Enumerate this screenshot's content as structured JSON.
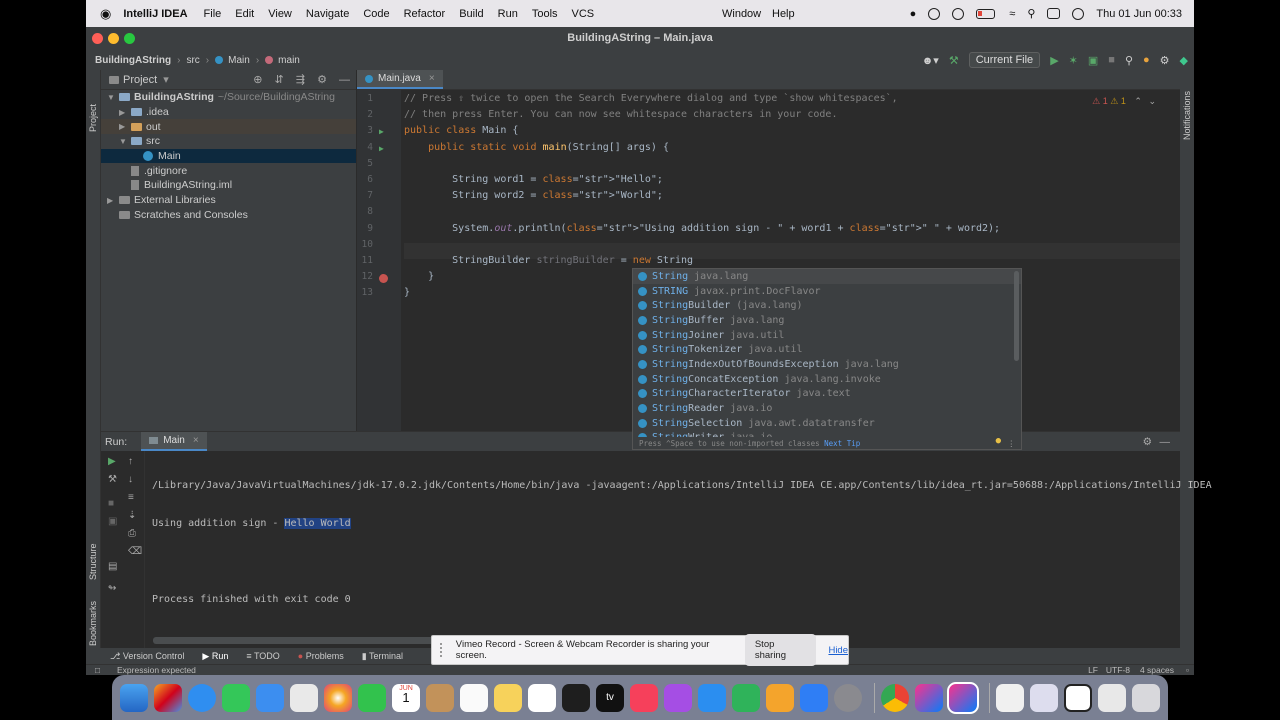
{
  "menubar": {
    "apple": "",
    "app": "IntelliJ IDEA",
    "items": [
      "File",
      "Edit",
      "View",
      "Navigate",
      "Code",
      "Refactor",
      "Build",
      "Run",
      "Tools",
      "VCS"
    ],
    "right_items": [
      "Window",
      "Help"
    ],
    "clock": "Thu 01 Jun  00:33"
  },
  "window": {
    "title": "BuildingAString – Main.java",
    "breadcrumb": [
      "BuildingAString",
      "src",
      "Main",
      "main"
    ],
    "run_config": "Current File"
  },
  "project": {
    "label": "Project",
    "tree": [
      {
        "name": "BuildingAString",
        "extra": "~/Source/BuildingAString",
        "depth": 0,
        "arrow": "▼",
        "icon": "folder-icon"
      },
      {
        "name": ".idea",
        "extra": "",
        "depth": 1,
        "arrow": "▶",
        "icon": "folder-icon"
      },
      {
        "name": "out",
        "extra": "",
        "depth": 1,
        "arrow": "▶",
        "icon": "folder-icon"
      },
      {
        "name": "src",
        "extra": "",
        "depth": 1,
        "arrow": "▼",
        "icon": "folder-icon"
      },
      {
        "name": "Main",
        "extra": "",
        "depth": 2,
        "arrow": "",
        "icon": "class-icon"
      },
      {
        "name": ".gitignore",
        "extra": "",
        "depth": 1,
        "arrow": "",
        "icon": "file-icon"
      },
      {
        "name": "BuildingAString.iml",
        "extra": "",
        "depth": 1,
        "arrow": "",
        "icon": "file-icon"
      },
      {
        "name": "External Libraries",
        "extra": "",
        "depth": 0,
        "arrow": "▶",
        "icon": "library-icon"
      },
      {
        "name": "Scratches and Consoles",
        "extra": "",
        "depth": 0,
        "arrow": "",
        "icon": "scratch-icon"
      }
    ]
  },
  "editor": {
    "tab": "Main.java",
    "status": {
      "errors": "1",
      "warnings": "1"
    },
    "line_numbers": [
      "1",
      "2",
      "3",
      "4",
      "5",
      "6",
      "7",
      "8",
      "9",
      "10",
      "11",
      "12",
      "13"
    ],
    "lines": [
      {
        "n": 1,
        "text": "// Press ⇧ twice to open the Search Everywhere dialog and type `show whitespaces`,"
      },
      {
        "n": 2,
        "text": "// then press Enter. You can now see whitespace characters in your code."
      },
      {
        "n": 3,
        "text": "public class Main {"
      },
      {
        "n": 4,
        "text": "    public static void main(String[] args) {"
      },
      {
        "n": 5,
        "text": ""
      },
      {
        "n": 6,
        "text": "        String word1 = \"Hello\";"
      },
      {
        "n": 7,
        "text": "        String word2 = \"World\";"
      },
      {
        "n": 8,
        "text": ""
      },
      {
        "n": 9,
        "text": "        System.out.println(\"Using addition sign - \" + word1 + \" \" + word2);"
      },
      {
        "n": 10,
        "text": ""
      },
      {
        "n": 11,
        "text": "        StringBuilder stringBuilder = new String"
      },
      {
        "n": 12,
        "text": "    }"
      },
      {
        "n": 13,
        "text": "}"
      }
    ]
  },
  "completion": {
    "items": [
      {
        "match": "String",
        "rest": "",
        "pkg": "java.lang"
      },
      {
        "match": "STRING",
        "rest": "",
        "pkg": "javax.print.DocFlavor"
      },
      {
        "match": "String",
        "rest": "Builder",
        "pkg": "(java.lang)"
      },
      {
        "match": "String",
        "rest": "Buffer",
        "pkg": "java.lang"
      },
      {
        "match": "String",
        "rest": "Joiner",
        "pkg": "java.util"
      },
      {
        "match": "String",
        "rest": "Tokenizer",
        "pkg": "java.util"
      },
      {
        "match": "String",
        "rest": "IndexOutOfBoundsException",
        "pkg": "java.lang"
      },
      {
        "match": "String",
        "rest": "ConcatException",
        "pkg": "java.lang.invoke"
      },
      {
        "match": "String",
        "rest": "CharacterIterator",
        "pkg": "java.text"
      },
      {
        "match": "String",
        "rest": "Reader",
        "pkg": "java.io"
      },
      {
        "match": "String",
        "rest": "Selection",
        "pkg": "java.awt.datatransfer"
      },
      {
        "match": "String",
        "rest": "Writer",
        "pkg": "java.io"
      }
    ],
    "tip": "Press ^Space to use non-imported classes",
    "next_tip": "Next Tip"
  },
  "run": {
    "label": "Run:",
    "tab": "Main",
    "console": {
      "command": "/Library/Java/JavaVirtualMachines/jdk-17.0.2.jdk/Contents/Home/bin/java -javaagent:/Applications/IntelliJ IDEA CE.app/Contents/lib/idea_rt.jar=50688:/Applications/IntelliJ IDEA",
      "output_prefix": "Using addition sign - ",
      "output_selected": "Hello World",
      "exit": "Process finished with exit code 0"
    }
  },
  "toolwindows": [
    "Version Control",
    "Run",
    "TODO",
    "Problems",
    "Terminal"
  ],
  "status": {
    "message": "Expression expected",
    "line_sep": "LF",
    "encoding": "UTF-8",
    "indent": "4 spaces"
  },
  "side_labels": {
    "project": "Project",
    "structure": "Structure",
    "bookmarks": "Bookmarks",
    "notifications": "Notifications"
  },
  "notification": {
    "text": "Vimeo Record - Screen & Webcam Recorder is sharing your screen.",
    "stop": "Stop sharing",
    "hide": "Hide"
  },
  "dock": {
    "calendar_month": "JUN",
    "calendar_day": "1",
    "tv_label": "tv"
  },
  "colors": {
    "accent": "#4a88c7",
    "keyword": "#cc7832",
    "string": "#6a8759",
    "comment": "#808080",
    "error": "#c75450"
  }
}
